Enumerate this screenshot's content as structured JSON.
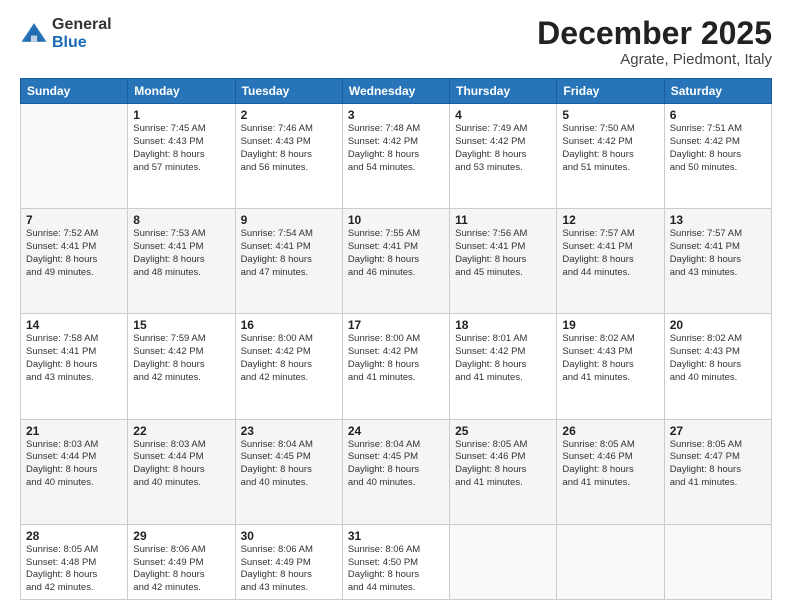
{
  "header": {
    "logo_general": "General",
    "logo_blue": "Blue",
    "month": "December 2025",
    "location": "Agrate, Piedmont, Italy"
  },
  "days_of_week": [
    "Sunday",
    "Monday",
    "Tuesday",
    "Wednesday",
    "Thursday",
    "Friday",
    "Saturday"
  ],
  "weeks": [
    [
      {
        "day": "",
        "info": ""
      },
      {
        "day": "1",
        "info": "Sunrise: 7:45 AM\nSunset: 4:43 PM\nDaylight: 8 hours\nand 57 minutes."
      },
      {
        "day": "2",
        "info": "Sunrise: 7:46 AM\nSunset: 4:43 PM\nDaylight: 8 hours\nand 56 minutes."
      },
      {
        "day": "3",
        "info": "Sunrise: 7:48 AM\nSunset: 4:42 PM\nDaylight: 8 hours\nand 54 minutes."
      },
      {
        "day": "4",
        "info": "Sunrise: 7:49 AM\nSunset: 4:42 PM\nDaylight: 8 hours\nand 53 minutes."
      },
      {
        "day": "5",
        "info": "Sunrise: 7:50 AM\nSunset: 4:42 PM\nDaylight: 8 hours\nand 51 minutes."
      },
      {
        "day": "6",
        "info": "Sunrise: 7:51 AM\nSunset: 4:42 PM\nDaylight: 8 hours\nand 50 minutes."
      }
    ],
    [
      {
        "day": "7",
        "info": "Sunrise: 7:52 AM\nSunset: 4:41 PM\nDaylight: 8 hours\nand 49 minutes."
      },
      {
        "day": "8",
        "info": "Sunrise: 7:53 AM\nSunset: 4:41 PM\nDaylight: 8 hours\nand 48 minutes."
      },
      {
        "day": "9",
        "info": "Sunrise: 7:54 AM\nSunset: 4:41 PM\nDaylight: 8 hours\nand 47 minutes."
      },
      {
        "day": "10",
        "info": "Sunrise: 7:55 AM\nSunset: 4:41 PM\nDaylight: 8 hours\nand 46 minutes."
      },
      {
        "day": "11",
        "info": "Sunrise: 7:56 AM\nSunset: 4:41 PM\nDaylight: 8 hours\nand 45 minutes."
      },
      {
        "day": "12",
        "info": "Sunrise: 7:57 AM\nSunset: 4:41 PM\nDaylight: 8 hours\nand 44 minutes."
      },
      {
        "day": "13",
        "info": "Sunrise: 7:57 AM\nSunset: 4:41 PM\nDaylight: 8 hours\nand 43 minutes."
      }
    ],
    [
      {
        "day": "14",
        "info": "Sunrise: 7:58 AM\nSunset: 4:41 PM\nDaylight: 8 hours\nand 43 minutes."
      },
      {
        "day": "15",
        "info": "Sunrise: 7:59 AM\nSunset: 4:42 PM\nDaylight: 8 hours\nand 42 minutes."
      },
      {
        "day": "16",
        "info": "Sunrise: 8:00 AM\nSunset: 4:42 PM\nDaylight: 8 hours\nand 42 minutes."
      },
      {
        "day": "17",
        "info": "Sunrise: 8:00 AM\nSunset: 4:42 PM\nDaylight: 8 hours\nand 41 minutes."
      },
      {
        "day": "18",
        "info": "Sunrise: 8:01 AM\nSunset: 4:42 PM\nDaylight: 8 hours\nand 41 minutes."
      },
      {
        "day": "19",
        "info": "Sunrise: 8:02 AM\nSunset: 4:43 PM\nDaylight: 8 hours\nand 41 minutes."
      },
      {
        "day": "20",
        "info": "Sunrise: 8:02 AM\nSunset: 4:43 PM\nDaylight: 8 hours\nand 40 minutes."
      }
    ],
    [
      {
        "day": "21",
        "info": "Sunrise: 8:03 AM\nSunset: 4:44 PM\nDaylight: 8 hours\nand 40 minutes."
      },
      {
        "day": "22",
        "info": "Sunrise: 8:03 AM\nSunset: 4:44 PM\nDaylight: 8 hours\nand 40 minutes."
      },
      {
        "day": "23",
        "info": "Sunrise: 8:04 AM\nSunset: 4:45 PM\nDaylight: 8 hours\nand 40 minutes."
      },
      {
        "day": "24",
        "info": "Sunrise: 8:04 AM\nSunset: 4:45 PM\nDaylight: 8 hours\nand 40 minutes."
      },
      {
        "day": "25",
        "info": "Sunrise: 8:05 AM\nSunset: 4:46 PM\nDaylight: 8 hours\nand 41 minutes."
      },
      {
        "day": "26",
        "info": "Sunrise: 8:05 AM\nSunset: 4:46 PM\nDaylight: 8 hours\nand 41 minutes."
      },
      {
        "day": "27",
        "info": "Sunrise: 8:05 AM\nSunset: 4:47 PM\nDaylight: 8 hours\nand 41 minutes."
      }
    ],
    [
      {
        "day": "28",
        "info": "Sunrise: 8:05 AM\nSunset: 4:48 PM\nDaylight: 8 hours\nand 42 minutes."
      },
      {
        "day": "29",
        "info": "Sunrise: 8:06 AM\nSunset: 4:49 PM\nDaylight: 8 hours\nand 42 minutes."
      },
      {
        "day": "30",
        "info": "Sunrise: 8:06 AM\nSunset: 4:49 PM\nDaylight: 8 hours\nand 43 minutes."
      },
      {
        "day": "31",
        "info": "Sunrise: 8:06 AM\nSunset: 4:50 PM\nDaylight: 8 hours\nand 44 minutes."
      },
      {
        "day": "",
        "info": ""
      },
      {
        "day": "",
        "info": ""
      },
      {
        "day": "",
        "info": ""
      }
    ]
  ]
}
